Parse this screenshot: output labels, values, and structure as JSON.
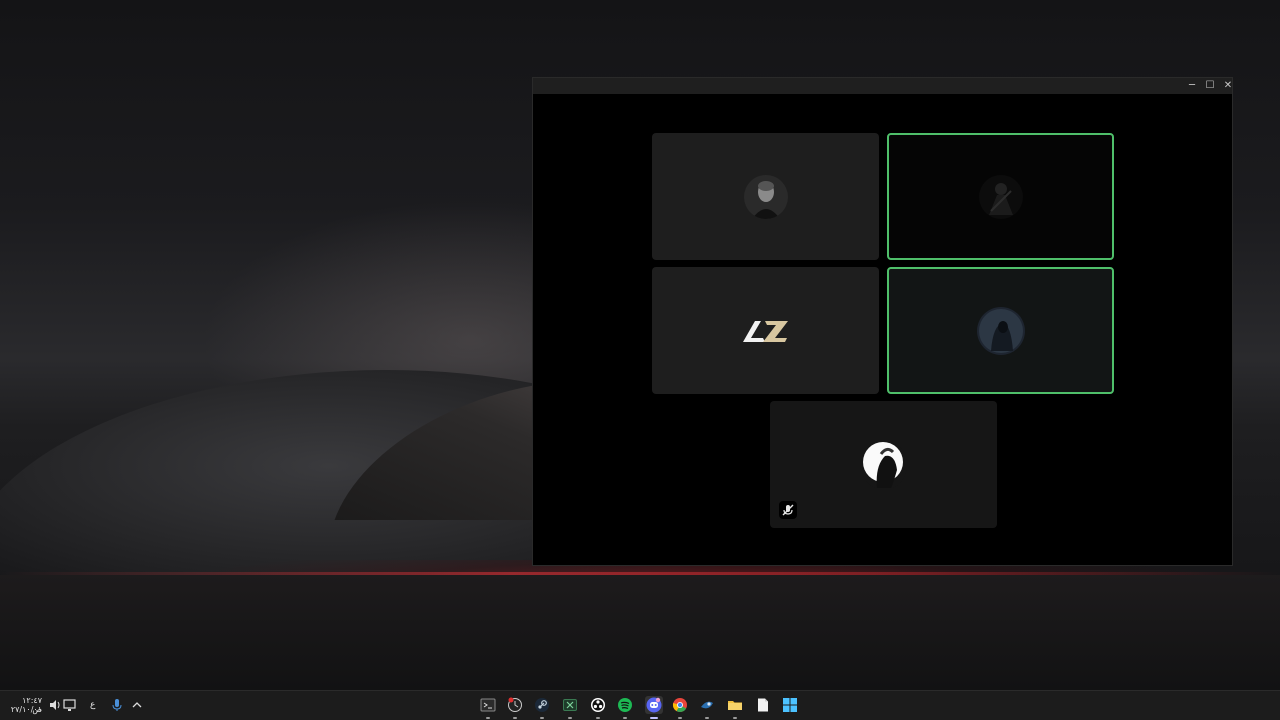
{
  "window": {
    "controls": {
      "minimize": "─",
      "maximize": "☐",
      "close": "✕"
    }
  },
  "call": {
    "participants": [
      {
        "id": "p1",
        "avatar": "man-portrait-avatar",
        "speaking": false,
        "muted": false
      },
      {
        "id": "p2",
        "avatar": "dark-figure-avatar",
        "speaking": true,
        "muted": false
      },
      {
        "id": "p3",
        "avatar": "az-logo-avatar",
        "logo_text": "AZ",
        "speaking": false,
        "muted": false
      },
      {
        "id": "p4",
        "avatar": "hooded-figure-avatar",
        "speaking": true,
        "muted": false
      },
      {
        "id": "p5",
        "avatar": "helmet-portrait-avatar",
        "speaking": false,
        "muted": true
      }
    ],
    "speaking_color": "#4fbf6a"
  },
  "taskbar": {
    "clock_time": "١٢:٤٧ ص",
    "clock_date": "٢٧/١٠/٠١",
    "language": "ع",
    "tray_icons": [
      "speaker-icon",
      "network-icon",
      "microphone-icon",
      "chevron-up-icon"
    ],
    "apps": [
      "terminal-icon",
      "clock-app-icon",
      "steam-icon",
      "excel-icon",
      "obs-icon",
      "spotify-icon",
      "discord-icon",
      "chrome-icon",
      "steam-alt-icon",
      "file-explorer-icon",
      "notepad-icon",
      "start-icon"
    ]
  }
}
